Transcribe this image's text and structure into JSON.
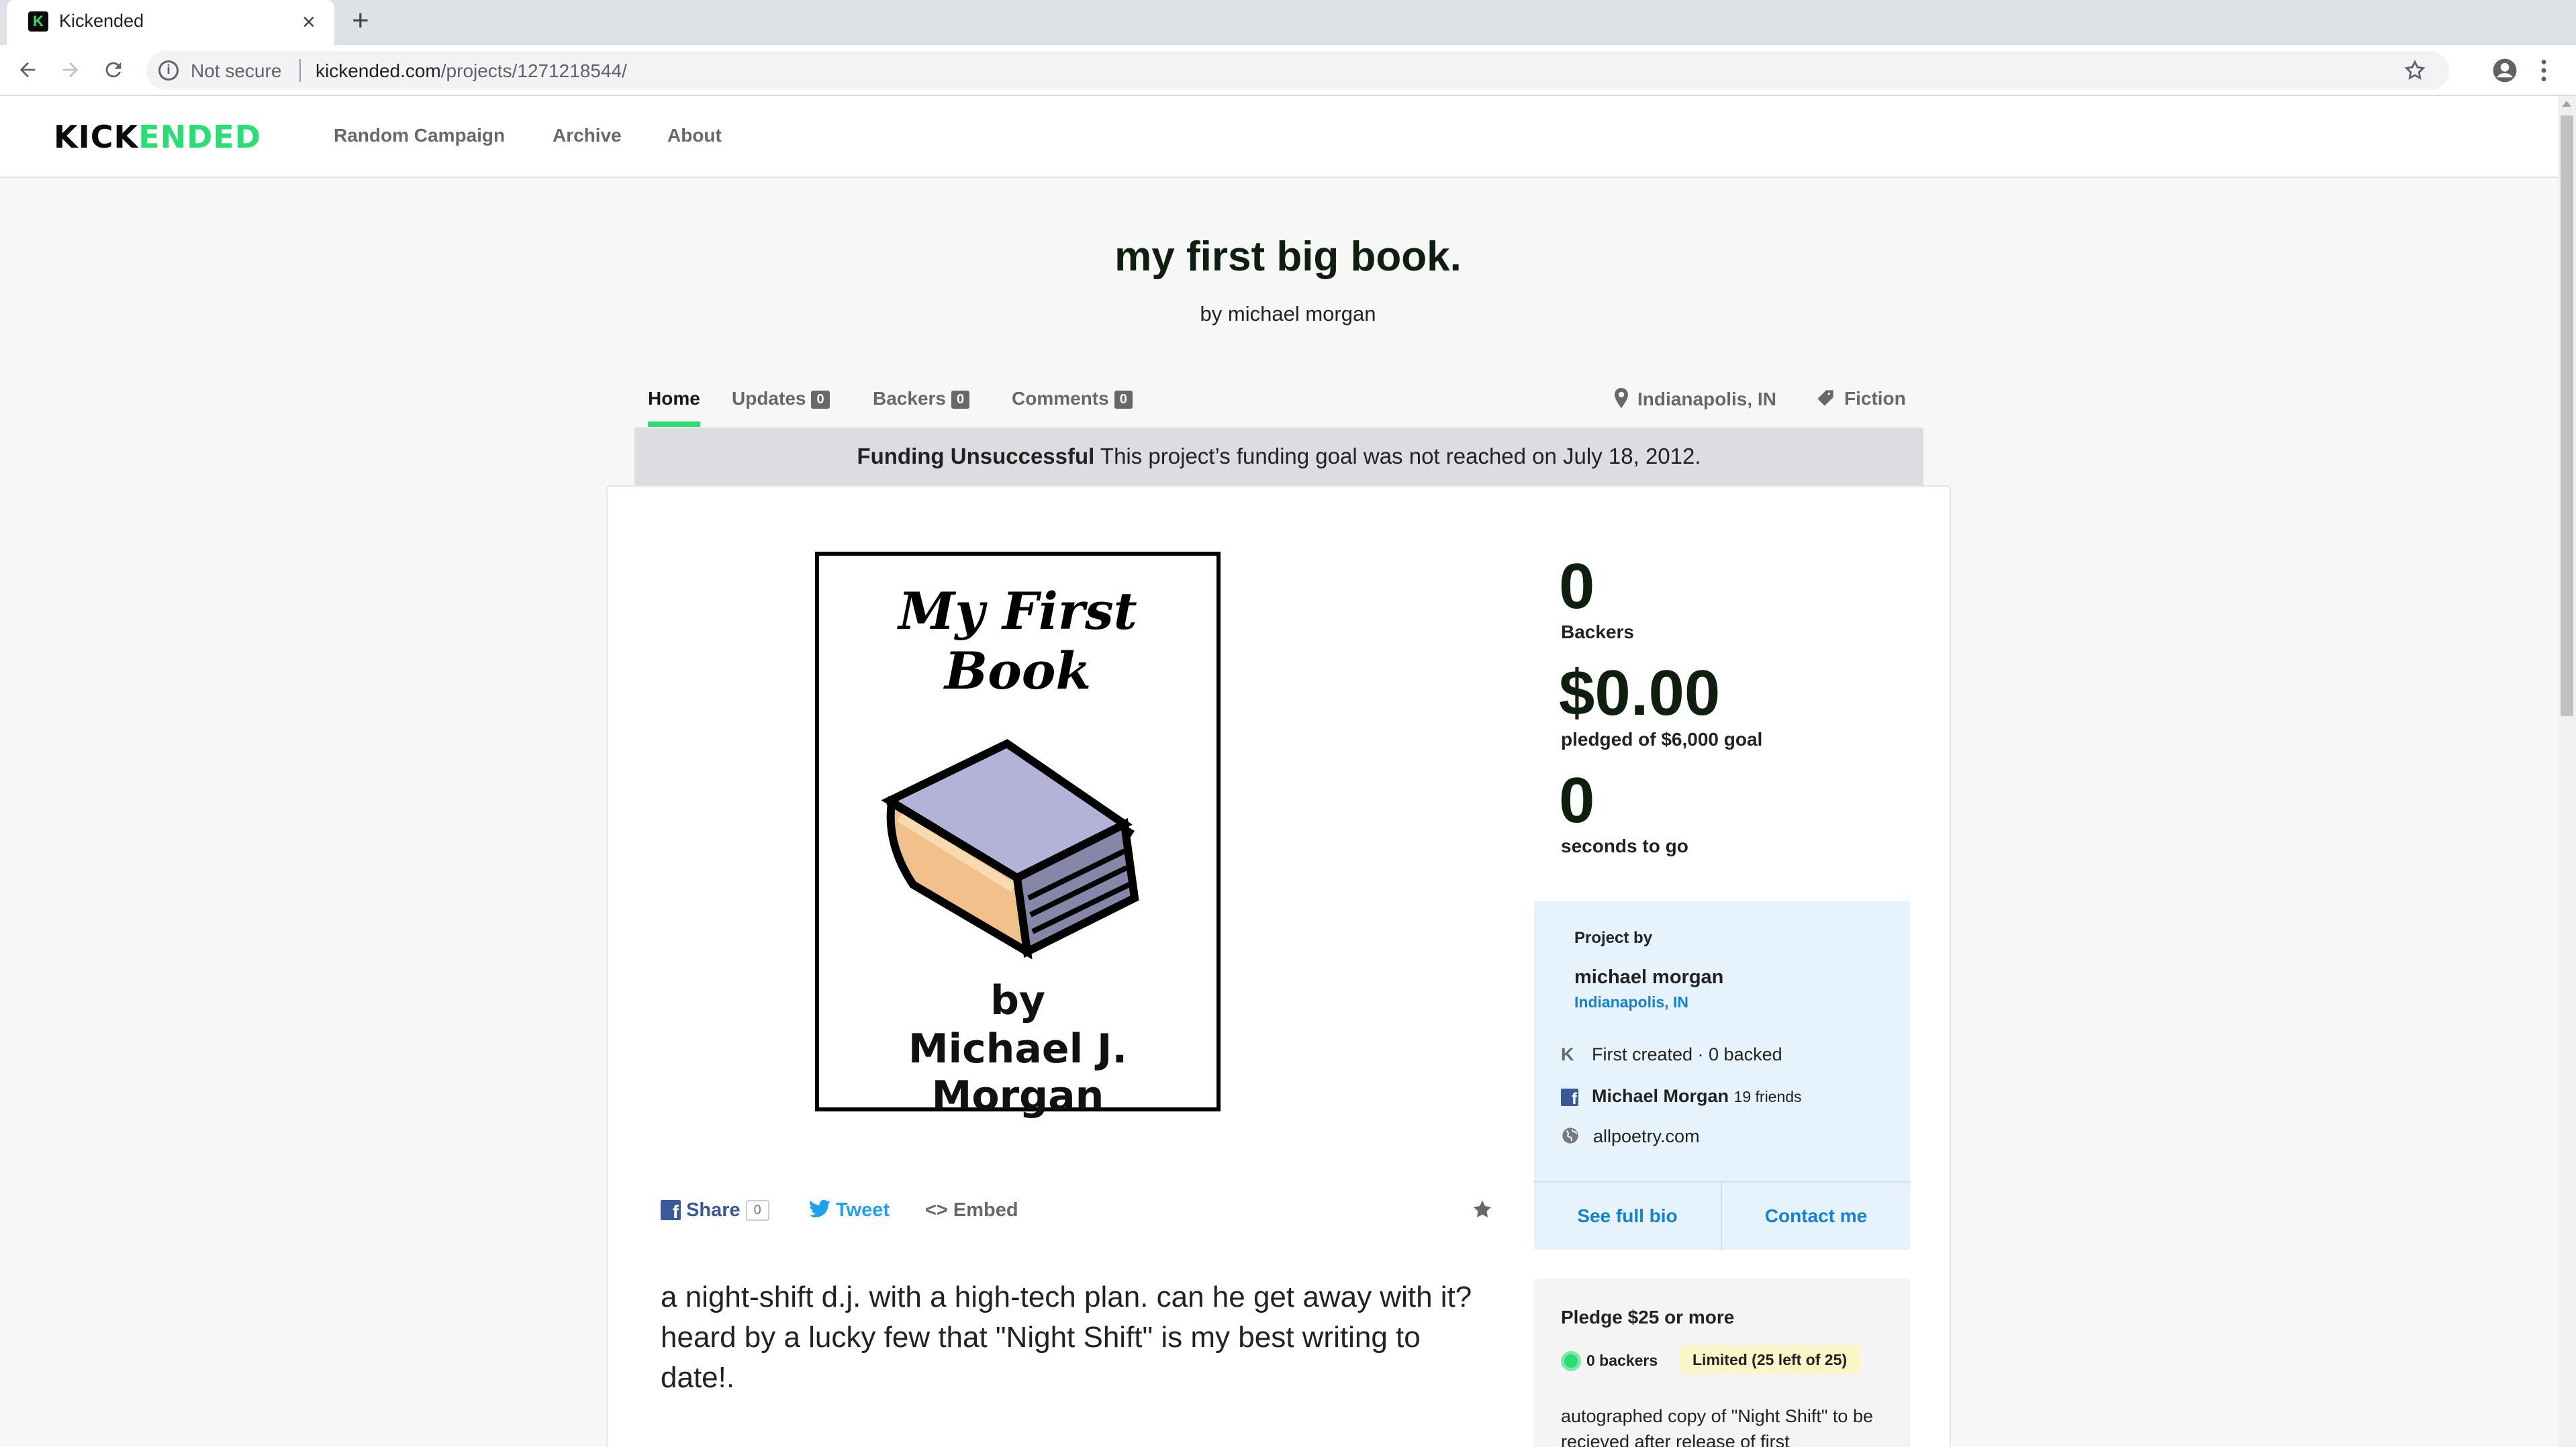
{
  "browser": {
    "tab_title": "Kickended",
    "tab_favicon_letter": "K",
    "new_tab_symbol": "+",
    "security_label": "Not secure",
    "url_domain": "kickended.com",
    "url_path": "/projects/1271218544/"
  },
  "nav": {
    "logo_part1": "KICK",
    "logo_part2": "ENDED",
    "links": [
      "Random Campaign",
      "Archive",
      "About"
    ]
  },
  "project": {
    "title": "my first big book.",
    "byline": "by michael morgan",
    "tabs": [
      {
        "label": "Home"
      },
      {
        "label": "Updates",
        "count": "0"
      },
      {
        "label": "Backers",
        "count": "0"
      },
      {
        "label": "Comments",
        "count": "0"
      }
    ],
    "location": "Indianapolis, IN",
    "category": "Fiction",
    "banner_bold": "Funding Unsuccessful",
    "banner_text": "This project’s funding goal was not reached on July 18, 2012.",
    "image": {
      "title": "My First Book",
      "by": "by",
      "author": "Michael J. Morgan"
    },
    "share": {
      "share_label": "Share",
      "share_count": "0",
      "tweet_label": "Tweet",
      "embed_label": "Embed"
    },
    "description": "a night-shift d.j. with a high-tech plan. can he get away with it? heard by a lucky few that \"Night Shift\" is my best writing to date!."
  },
  "stats": {
    "backers_value": "0",
    "backers_label": "Backers",
    "pledged_value": "$0.00",
    "pledged_label": "pledged of $6,000 goal",
    "time_value": "0",
    "time_label": "seconds to go"
  },
  "creator": {
    "heading": "Project by",
    "name": "michael morgan",
    "location": "Indianapolis, IN",
    "history": "First created · 0 backed",
    "facebook_name": "Michael Morgan",
    "facebook_friends": "19 friends",
    "website": "allpoetry.com",
    "bio_button": "See full bio",
    "contact_button": "Contact me"
  },
  "reward": {
    "heading": "Pledge $25 or more",
    "backers": "0 backers",
    "limit": "Limited (25 left of 25)",
    "description": "autographed copy of \"Night Shift\" to be recieved after release of first"
  },
  "colors": {
    "brand_green": "#2bde73",
    "title_dark": "#0f1f0f",
    "link_blue": "#1581d4",
    "facebook_blue": "#3b5998",
    "twitter_blue": "#1da1f2"
  }
}
